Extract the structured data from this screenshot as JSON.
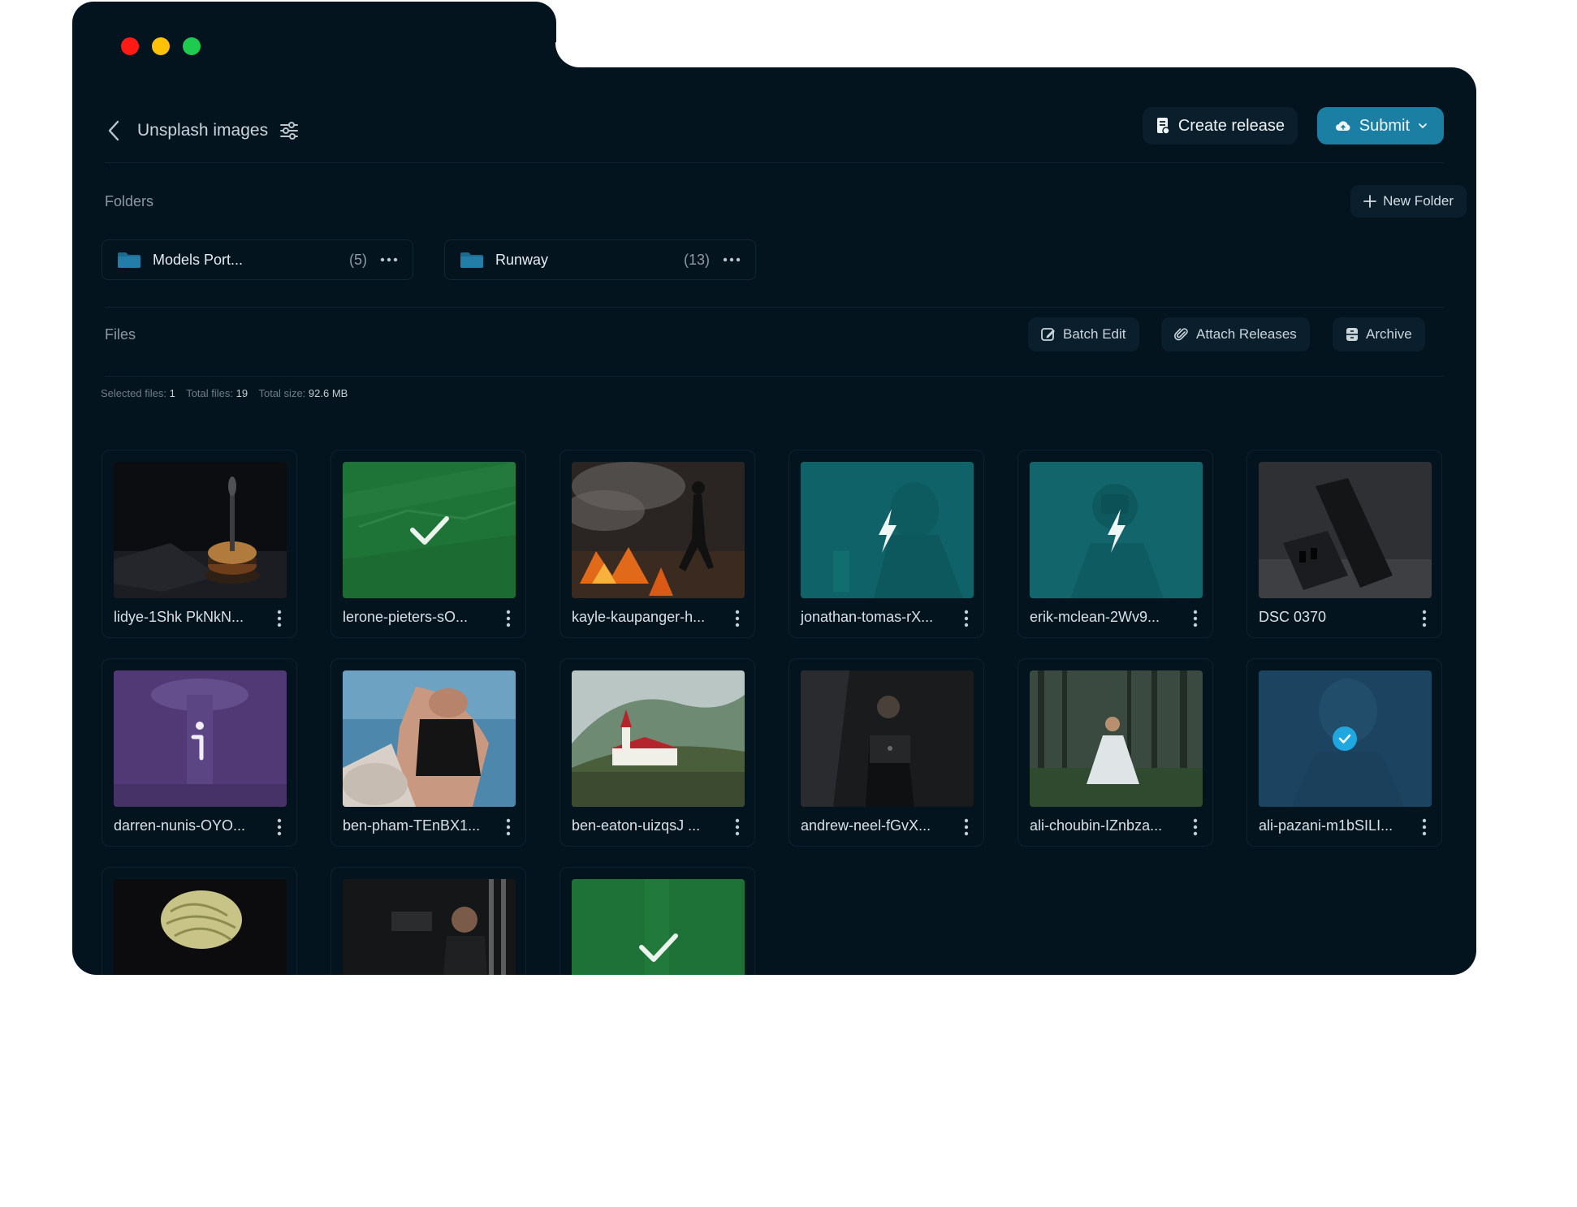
{
  "header": {
    "title": "Unsplash images",
    "create_release_label": "Create release",
    "submit_label": "Submit"
  },
  "folders": {
    "label": "Folders",
    "new_folder_label": "New Folder",
    "items": [
      {
        "name": "Models Port...",
        "count": "(5)"
      },
      {
        "name": "Runway",
        "count": "(13)"
      }
    ]
  },
  "files": {
    "label": "Files",
    "batch_edit_label": "Batch Edit",
    "attach_releases_label": "Attach Releases",
    "archive_label": "Archive",
    "stats": {
      "selected_label": "Selected files:",
      "selected_value": "1",
      "total_label": "Total files:",
      "total_value": "19",
      "size_label": "Total size:",
      "size_value": "92.6 MB"
    },
    "items": [
      {
        "name": "lidye-1Shk PkNkN...",
        "status": "none"
      },
      {
        "name": "lerone-pieters-sO...",
        "status": "approved"
      },
      {
        "name": "kayle-kaupanger-h...",
        "status": "none"
      },
      {
        "name": "jonathan-tomas-rX...",
        "status": "processing"
      },
      {
        "name": "erik-mclean-2Wv9...",
        "status": "processing"
      },
      {
        "name": "DSC 0370",
        "status": "none"
      },
      {
        "name": "darren-nunis-OYO...",
        "status": "info"
      },
      {
        "name": "ben-pham-TEnBX1...",
        "status": "none"
      },
      {
        "name": "ben-eaton-uizqsJ ...",
        "status": "none"
      },
      {
        "name": "andrew-neel-fGvX...",
        "status": "none"
      },
      {
        "name": "ali-choubin-IZnbza...",
        "status": "none"
      },
      {
        "name": "ali-pazani-m1bSILI...",
        "status": "selected"
      },
      {
        "name": "",
        "status": "none"
      },
      {
        "name": "",
        "status": "none"
      },
      {
        "name": "",
        "status": "approved"
      }
    ]
  },
  "colors": {
    "window_bg": "#04141f",
    "accent": "#1b7fa3",
    "approved_overlay": "#1f7a3a",
    "processing_overlay": "#0f6a6e",
    "info_overlay": "#5a3a82",
    "selected_overlay": "#1d4a6a"
  }
}
